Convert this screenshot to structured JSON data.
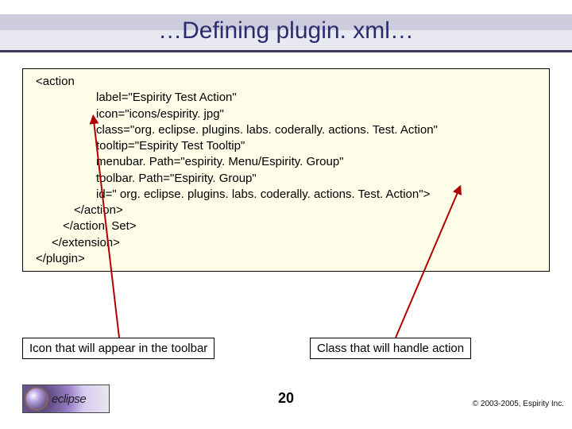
{
  "title": "…Defining plugin. xml…",
  "code": {
    "open": "<action",
    "attrs": {
      "label": "label=\"Espirity Test Action\"",
      "icon": "icon=\"icons/espirity. jpg\"",
      "classAttr": "class=\"org. eclipse. plugins. labs. coderally. actions. Test. Action\"",
      "tooltip": "tooltip=\"Espirity Test Tooltip\"",
      "menubar": "menubar. Path=\"espirity. Menu/Espirity. Group\"",
      "toolbar": "toolbar. Path=\"Espirity. Group\"",
      "id": "id=\" org. eclipse. plugins. labs. coderally. actions. Test. Action\">"
    },
    "close": {
      "action": "</action>",
      "actionSet": "</action. Set>",
      "extension": "</extension>",
      "plugin": "</plugin>"
    }
  },
  "callouts": {
    "left": "Icon that will appear in the toolbar",
    "right": "Class that will handle action"
  },
  "page": "20",
  "copyright": "© 2003-2005, Espirity Inc.",
  "logo_text": "eclipse"
}
